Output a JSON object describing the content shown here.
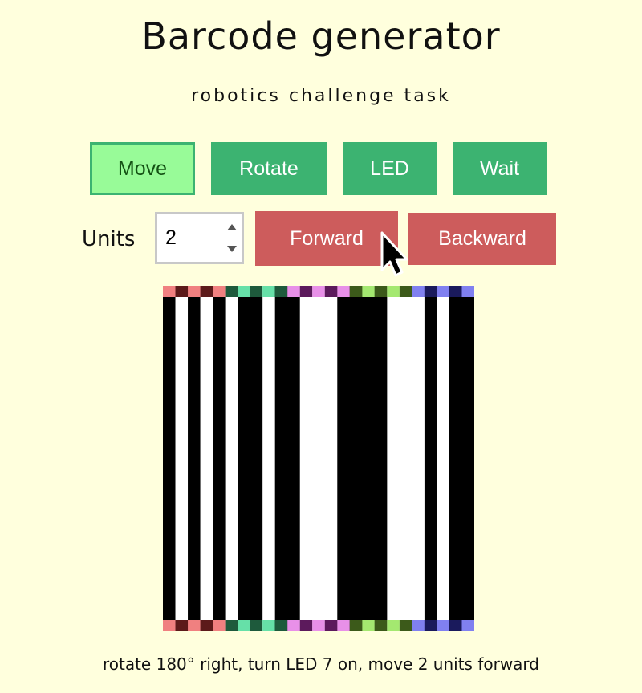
{
  "header": {
    "title": "Barcode generator",
    "subtitle": "robotics challenge task"
  },
  "commands": {
    "items": [
      {
        "label": "Move",
        "active": true
      },
      {
        "label": "Rotate",
        "active": false
      },
      {
        "label": "LED",
        "active": false
      },
      {
        "label": "Wait",
        "active": false
      }
    ]
  },
  "options": {
    "units_label": "Units",
    "units_value": "2",
    "forward_label": "Forward",
    "backward_label": "Backward"
  },
  "barcode": {
    "columns": "BWBWBWBBWBBWWWBBBBWWWBWBB",
    "marker_colors": [
      [
        "#f08080",
        "#5c1a1a"
      ],
      [
        "#66e0a8",
        "#1e5a3c"
      ],
      [
        "#e890e8",
        "#5c1a5c"
      ],
      [
        "#a4e870",
        "#3c5a1a"
      ],
      [
        "#8080f0",
        "#1a1a5c"
      ]
    ]
  },
  "description": "rotate 180° right, turn LED 7 on, move 2 units forward",
  "colors": {
    "background": "#ffffdd",
    "command_button": "#3cb371",
    "command_button_active": "#98fb98",
    "direction_button": "#cd5c5c"
  }
}
